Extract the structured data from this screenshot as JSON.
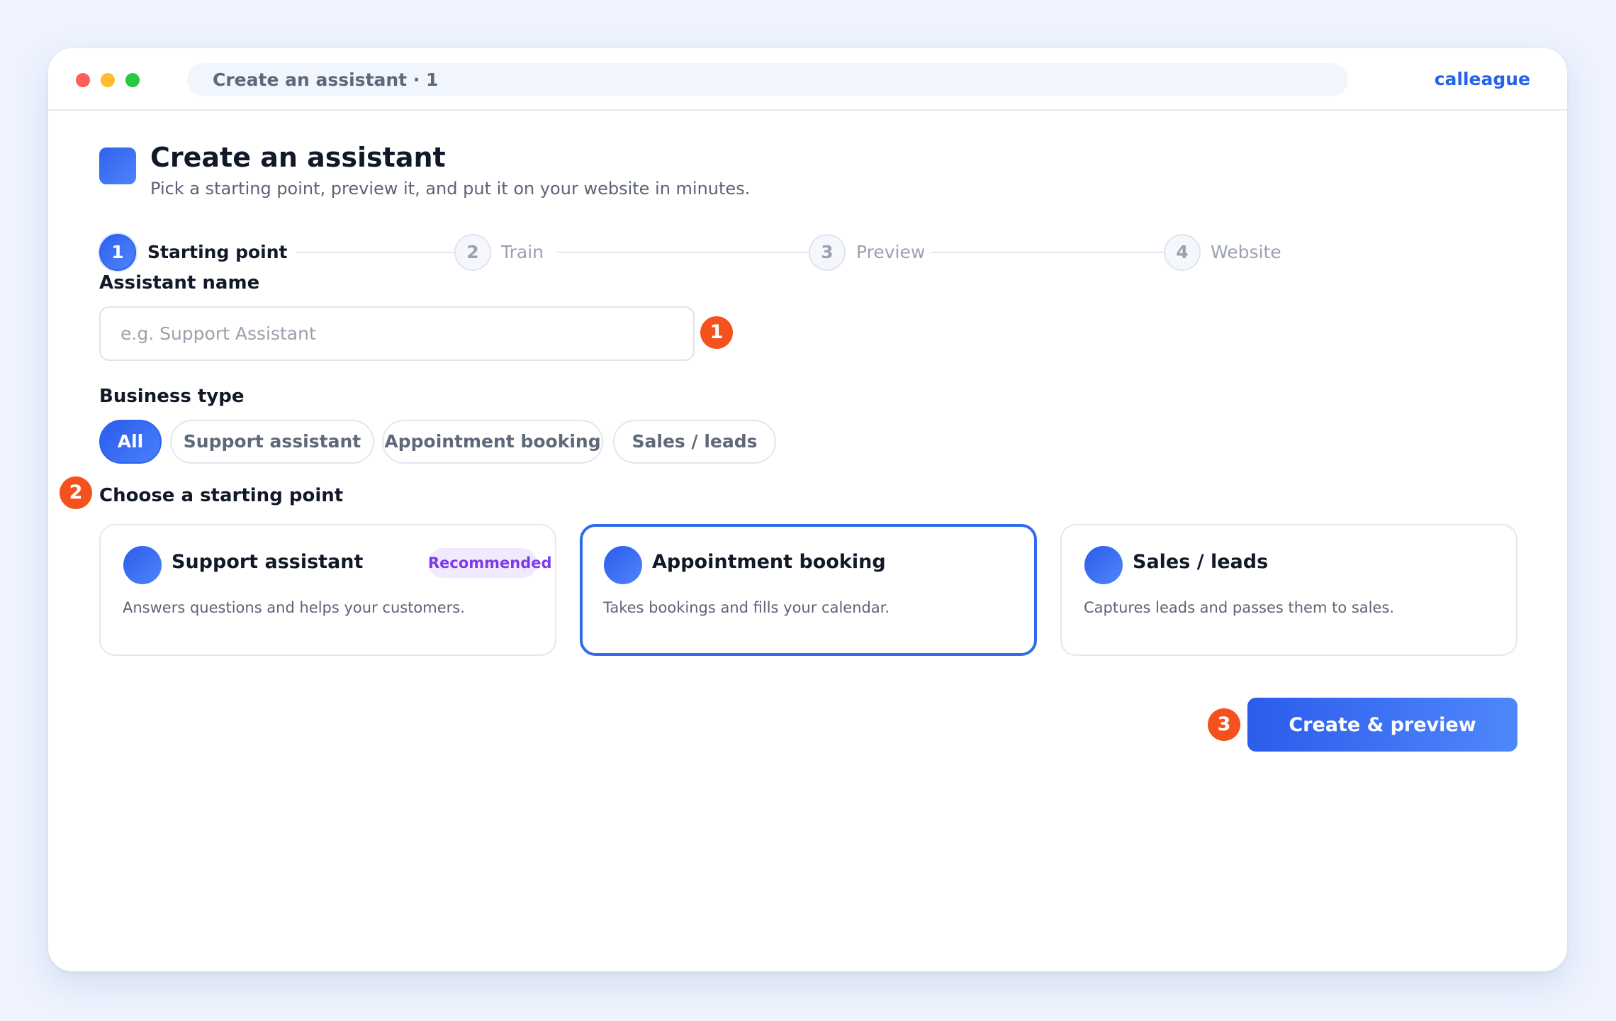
{
  "window": {
    "address_text": "Create an assistant · 1",
    "brand": "calleague"
  },
  "header": {
    "title": "Create an assistant",
    "subtitle": "Pick a starting point, preview it, and put it on your website in minutes."
  },
  "stepper": {
    "steps": [
      {
        "number": "1",
        "label": "Starting point",
        "state": "active"
      },
      {
        "number": "2",
        "label": "Train",
        "state": "inactive"
      },
      {
        "number": "3",
        "label": "Preview",
        "state": "inactive"
      },
      {
        "number": "4",
        "label": "Website",
        "state": "inactive"
      }
    ]
  },
  "form": {
    "name_label": "Assistant name",
    "name_value": "",
    "name_placeholder": "e.g. Support Assistant",
    "business_type_label": "Business type",
    "business_types": [
      {
        "label": "All",
        "selected": true
      },
      {
        "label": "Support assistant",
        "selected": false
      },
      {
        "label": "Appointment booking",
        "selected": false
      },
      {
        "label": "Sales / leads",
        "selected": false
      }
    ],
    "starting_point_label": "Choose a starting point"
  },
  "cards": [
    {
      "title": "Support assistant",
      "badge": "Recommended",
      "description": "Answers questions and helps your customers.",
      "selected": false
    },
    {
      "title": "Appointment booking",
      "badge": "",
      "description": "Takes bookings and fills your calendar.",
      "selected": true
    },
    {
      "title": "Sales / leads",
      "badge": "",
      "description": "Captures leads and passes them to sales.",
      "selected": false
    }
  ],
  "actions": {
    "primary_label": "Create & preview"
  },
  "markers": [
    "1",
    "2",
    "3"
  ],
  "colors": {
    "accent": "#2f62ee",
    "marker": "#f4511e",
    "badge_text": "#7c3aed",
    "badge_bg": "#f1eafe",
    "background": "#eef3fe"
  }
}
